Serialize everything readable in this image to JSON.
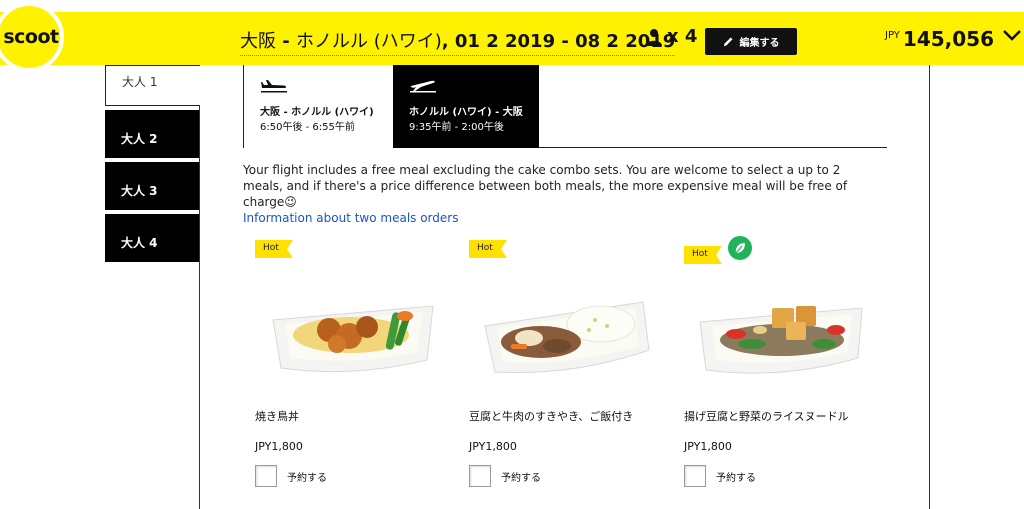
{
  "header": {
    "logo_text": "scoot",
    "route_from": "大阪",
    "route_sep": " - ",
    "route_to": "ホノルル (ハワイ)",
    "dates": ", 01 2 2019 - 08 2 2019",
    "passenger_count": "x 4",
    "edit_label": "編集する",
    "currency": "JPY",
    "total_price": "145,056"
  },
  "passengers": [
    {
      "label": "大人 1",
      "active": true
    },
    {
      "label": "大人 2",
      "active": false
    },
    {
      "label": "大人 3",
      "active": false
    },
    {
      "label": "大人 4",
      "active": false
    }
  ],
  "flights": [
    {
      "name": "大阪 - ホノルル (ハワイ)",
      "time": "6:50午後 - 6:55午前",
      "active": true
    },
    {
      "name": "ホノルル (ハワイ) - 大阪",
      "time": "9:35午前 - 2:00午後",
      "active": false
    }
  ],
  "info": {
    "text": "Your flight includes a free meal excluding the cake combo sets. You are welcome to select a up to 2 meals, and if there's a price difference between both meals, the more expensive meal will be free of charge😉",
    "link": "Information about two meals orders"
  },
  "meals": [
    {
      "badge": "Hot",
      "name": "焼き鳥丼",
      "price": "JPY1,800",
      "book_label": "予約する",
      "vegetarian": false
    },
    {
      "badge": "Hot",
      "name": "豆腐と牛肉のすきやき、ご飯付き",
      "price": "JPY1,800",
      "book_label": "予約する",
      "vegetarian": false
    },
    {
      "badge": "Hot",
      "name": "揚げ豆腐と野菜のライスヌードル",
      "price": "JPY1,800",
      "book_label": "予約する",
      "vegetarian": true
    }
  ],
  "icons": {
    "user": "user-icon",
    "pencil": "pencil-icon",
    "chevron": "chevron-down-icon",
    "takeoff": "plane-takeoff-icon",
    "landing": "plane-landing-icon",
    "leaf": "leaf-icon"
  },
  "colors": {
    "brand_yellow": "#fff200",
    "badge_yellow": "#ffe100",
    "link_blue": "#1a55c8",
    "veg_green": "#21b35a"
  }
}
